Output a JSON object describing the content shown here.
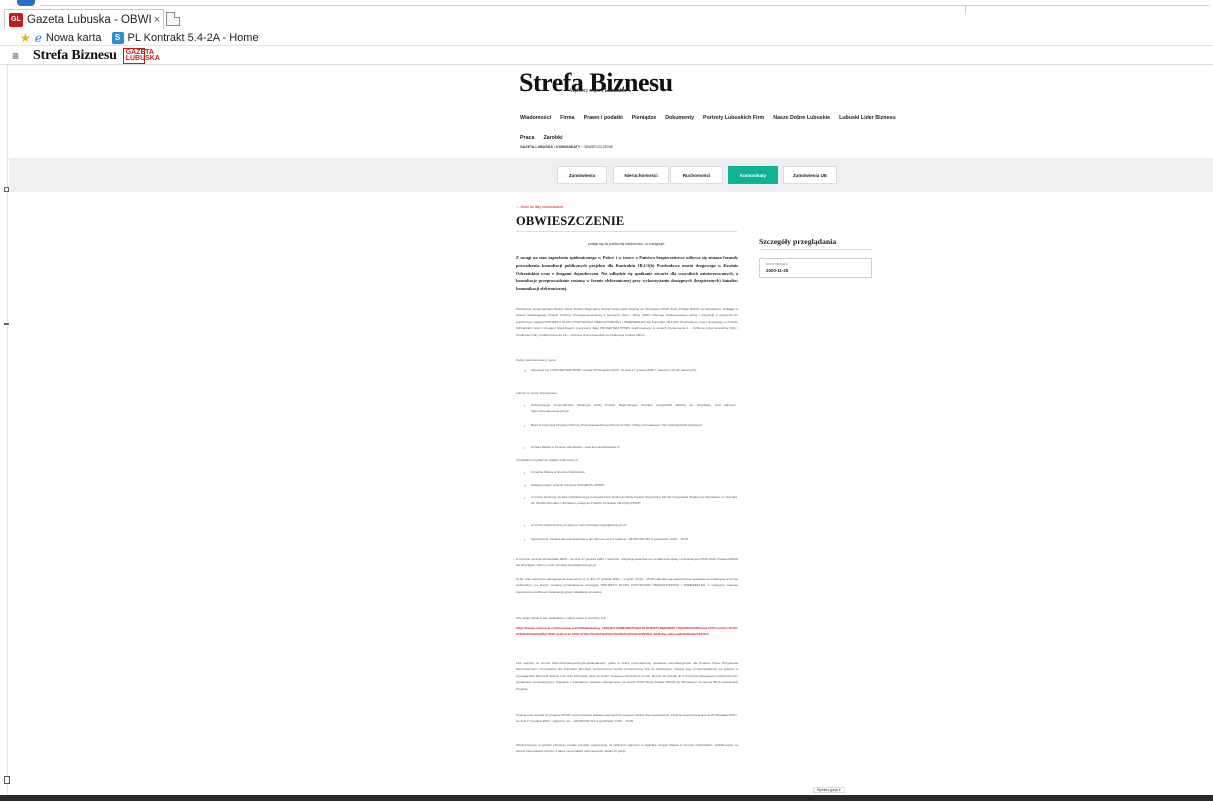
{
  "browser": {
    "tab_favicon": "GL",
    "tab_title": "Gazeta Lubuska - OBWIESZ...",
    "tab_close": "×",
    "favorites": [
      {
        "label": "Nowa karta",
        "icon": "ie-icon"
      },
      {
        "label": "PL Kontrakt 5.4-2A - Home",
        "icon": "sharepoint-icon",
        "badge": "S"
      }
    ]
  },
  "site": {
    "brand": "Strefa Biznesu",
    "gl_badge": "GAZETA LUBUSKA",
    "masthead": "Strefa Biznesu",
    "region_prefix": "Wybierz region",
    "region_value": "Lubuskie",
    "nav_row1": [
      "Wiadomości",
      "Firma",
      "Prawo i podatki",
      "Pieniądze",
      "Dokumenty",
      "Portrety Lubuskich Firm",
      "Nasze Dobre Lubuskie",
      "Lubuski Lider Biznesu"
    ],
    "nav_row2": [
      "Praca",
      "Zarobki"
    ],
    "breadcrumb": [
      "GAZETA LUBUSKA",
      "KOMUNIKATY",
      "OBWIESZCZENIE"
    ],
    "categories": [
      "Zamówienia",
      "Nieruchomości",
      "Ruchomości",
      "Komunikaty",
      "Zamówienia UE"
    ],
    "active_category": "Komunikaty"
  },
  "article": {
    "back": "← Wróć do listy komunikatów",
    "title": "OBWIESZCZENIE",
    "sponsor": "podaje się do publicznej wiadomości, co następuje:",
    "lead": "Z uwagi na stan zagrożenia epidemicznego w Polsce i w trosce o Państwa bezpieczeństwo odbywa się zmiana formuły prowadzenia konsultacji publicznych projektu dla Kontraktu 1B.1/1(b) Przebudowa mostu drogowego w Krośnie Odrzańskim wraz z drogami dojazdowymi. Nie odbędzie się spotkanie otwarte dla wszystkich zainteresowanych, a konsultacje przeprowadzone zostaną w formie elektronicznej przy wykorzystaniu dostępnych (bezpiecznych) kanałów komunikacji elektronicznej.",
    "p1": "Państwowe Gospodarstwo Wodne Wody Polskie Regionalny Zarząd Gospodarki Wodnej we Wrocławiu (PGW Wody Polskie RZGW we Wrocławiu), działając w imieniu Realizującego Projekt Ochrony Przeciwpowodziowej w Dorzeczu Odry i Wisły (JRP) informuje zainteresowane osoby i instytucje o wyłożeniu do publicznego wglądu PROJEKTU PLANU POZYSKANIA NIERUCHOMOŚCI I PRZESIEDLEŃ dla Kontraktu 1B.1/1(b) Przebudowa mostu drogowego w Krośnie Odrzańskim wraz z drogami dojazdowymi (nazywany dalej PROJEKTEM PPNiP) realizowanego w ramach Komponentu 1 – Ochrona przed powodzią Odry i Środkowej Odry, Podkomponentu 1B – Ochrona przed powodzią na Środkowej i Dolnej Odrze.",
    "p2": "Każdy zainteresowany może:",
    "li1": "zapoznać się z PROJEKTEM PPNiP od dnia 20 listopada 2020 r. do dnia 17 grudnia 2020 r. włącznie (10 dni roboczych);",
    "p3": "pobrać ze strony internetowej:",
    "b1": "Państwowego Gospodarstwa Wodnego Wody Polskie Regionalnego Zarządu Gospodarki Wodnej we Wrocławiu, pod adresem: https://wroclaw.wody.gov.pl/",
    "b2": "Biura Koordynacji Projektu Ochrony Przeciwpowodziowej Dorzecza Odry i Wisły, pod adresem: http://odrapw2019.odrapw.pl/",
    "b3": "Urzędu Miasta w Krośnie Odrzańskim: www.krosnoodrzanskie.pl",
    "p4": "i bezpłatnie uzyskać do wglądu dokumenty w:",
    "b4": "Urzędzie Miasta w Krośnie Odrzańskim",
    "li2": "składać uwagi i wnioski odnośnie PROJEKTU PPNiP:",
    "b5": "w formie pisemnej na adres Państwowego Gospodarstwa Wodnego Wody Polskie Regionalny Zarząd Gospodarki Wodnej we Wrocławiu, ul. Norwida 34, 50-950 Wrocław z dopiskiem „uwagi do Projektu Kontraktu 1B.1/1(b) PPNiP\"",
    "b6": "w formie elektronicznej na adres e-mail: jaroslaw.rzepka@wody.gov.pl",
    "b7": "telefonicznie: infolinia dla mieszkańców w dni robocze pod nr telefonu +48 000 000 110 w godzinach 14:00 – 15:00.",
    "p5": "w terminie od dnia 20 listopada 2020 r. do dnia 17 grudnia 2020 r. włącznie. Instytucją właściwą do rozpatrzenia uwag i wniosków jest PGW Wody Polskie RZGW we Wrocławiu. Adres e-mail: jaroslaw.rzepka@wody.gov.pl",
    "p6": "W 10. dniu roboczym udostępnienia dokumentu, tj. w dniu 17 grudnia 2020 r., w godz. 14:00 – 15:00 odbędzie się elektroniczne spotkanie konsultacyjne w formie webinarium, na którym zostaną przedstawione szczegóły PROJEKTU PLANU POZYSKANIA NIERUCHOMOŚCI I PRZESIEDLEŃ, a następnie zostanie zapewniona możliwość zadawania pytań i składania wniosków.",
    "p7": "Aby wziąć udział w ww. webinarium, należy wejść w poniższy link:",
    "link": "https://teams.microsoft.com/l/meetup-join/19%3ameeting_YWQ4ZmYtNDEzMi00YjdkLTk4OTItNTY4NjEtM2ZhYTQ1N2E4%40thread.v2/0?context=%7b%22Tid%22%3a%225e7d7d5-4e18-4c4e-b7b9-d7b5e77bc0e5%22%2c%22Oid%22%3a%2294ff4c-42d6-4ae-a4ba-ea912d2f2a2e%22%7d",
    "p8": "Link wejścia na stronie https://wroclaw.wody.gov.pl/aktualności, gdzie w sekcji przeznaczonej spotkaniu konsultacyjnemu dla Projektu Planu Pozyskania Nieruchomości i Przesiedleń dla Kontraktu 1B.1/1(b) zamieszczony będzie przedmiotowy link do webinarium. Zasady jego przeprowadzenia są opisane w wymaganiach Microsoft Teams. Link oraz informacje „krok po kroku\" zostaną umieszczone na ww. stronie nie później niż 5 dni przed planowanym elektronicznym spotkaniem konsultacyjnym. Nagranie z webinarium zostanie udostępnione na stronie PGW Wody Polskie RZGW we Wrocławiu i na stronie Biura Koordynacji Projektu.",
    "p9": "Pytania oraz wnioski do projektu PPNiP można również składać telefonicznie poprzez infolinię dla mieszkańców: infolinia uruchomiona jest od 20 listopada 2020 r. do dnia 17 grudnia 2020 r. włącznie, tel.: +48 000 000 110 w godzinach 14:00 – 15:00.",
    "p10": "Obwieszczenie w postaci pisemnej zostało ponadto wywieszone na tablicach ogłoszeń w siedzibie Urzędu Miasta w Krośnie Odrzańskim, opublikowane na stronie internetowej Urzędu, a także na portalach internetowych lokalnych gazet."
  },
  "sidebar": {
    "title": "Szczegóły przeglądania",
    "date_label": "DATA PUBLIKACJI",
    "date": "2020-11-25"
  },
  "footer": {
    "lang_select": "Wybierz język ▾"
  }
}
